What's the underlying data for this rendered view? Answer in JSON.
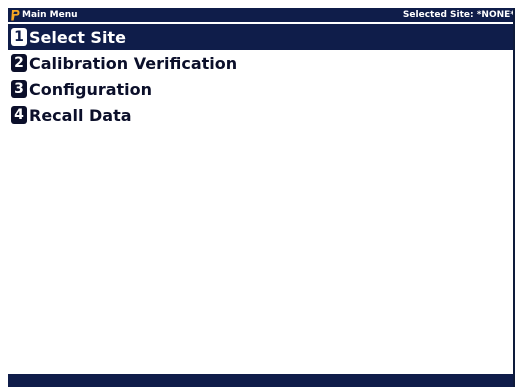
{
  "titlebar": {
    "logo_icon": "p-logo-icon",
    "title": "Main Menu",
    "site_status": "Selected Site: *NONE*"
  },
  "menu": {
    "items": [
      {
        "key": "1",
        "label": "Select Site",
        "selected": true
      },
      {
        "key": "2",
        "label": "Calibration Verification",
        "selected": false
      },
      {
        "key": "3",
        "label": "Configuration",
        "selected": false
      },
      {
        "key": "4",
        "label": "Recall Data",
        "selected": false
      }
    ]
  },
  "colors": {
    "bar_background": "#0f1d4a",
    "logo_accent": "#f5a623",
    "text": "#0b0f2a",
    "background": "#ffffff"
  }
}
